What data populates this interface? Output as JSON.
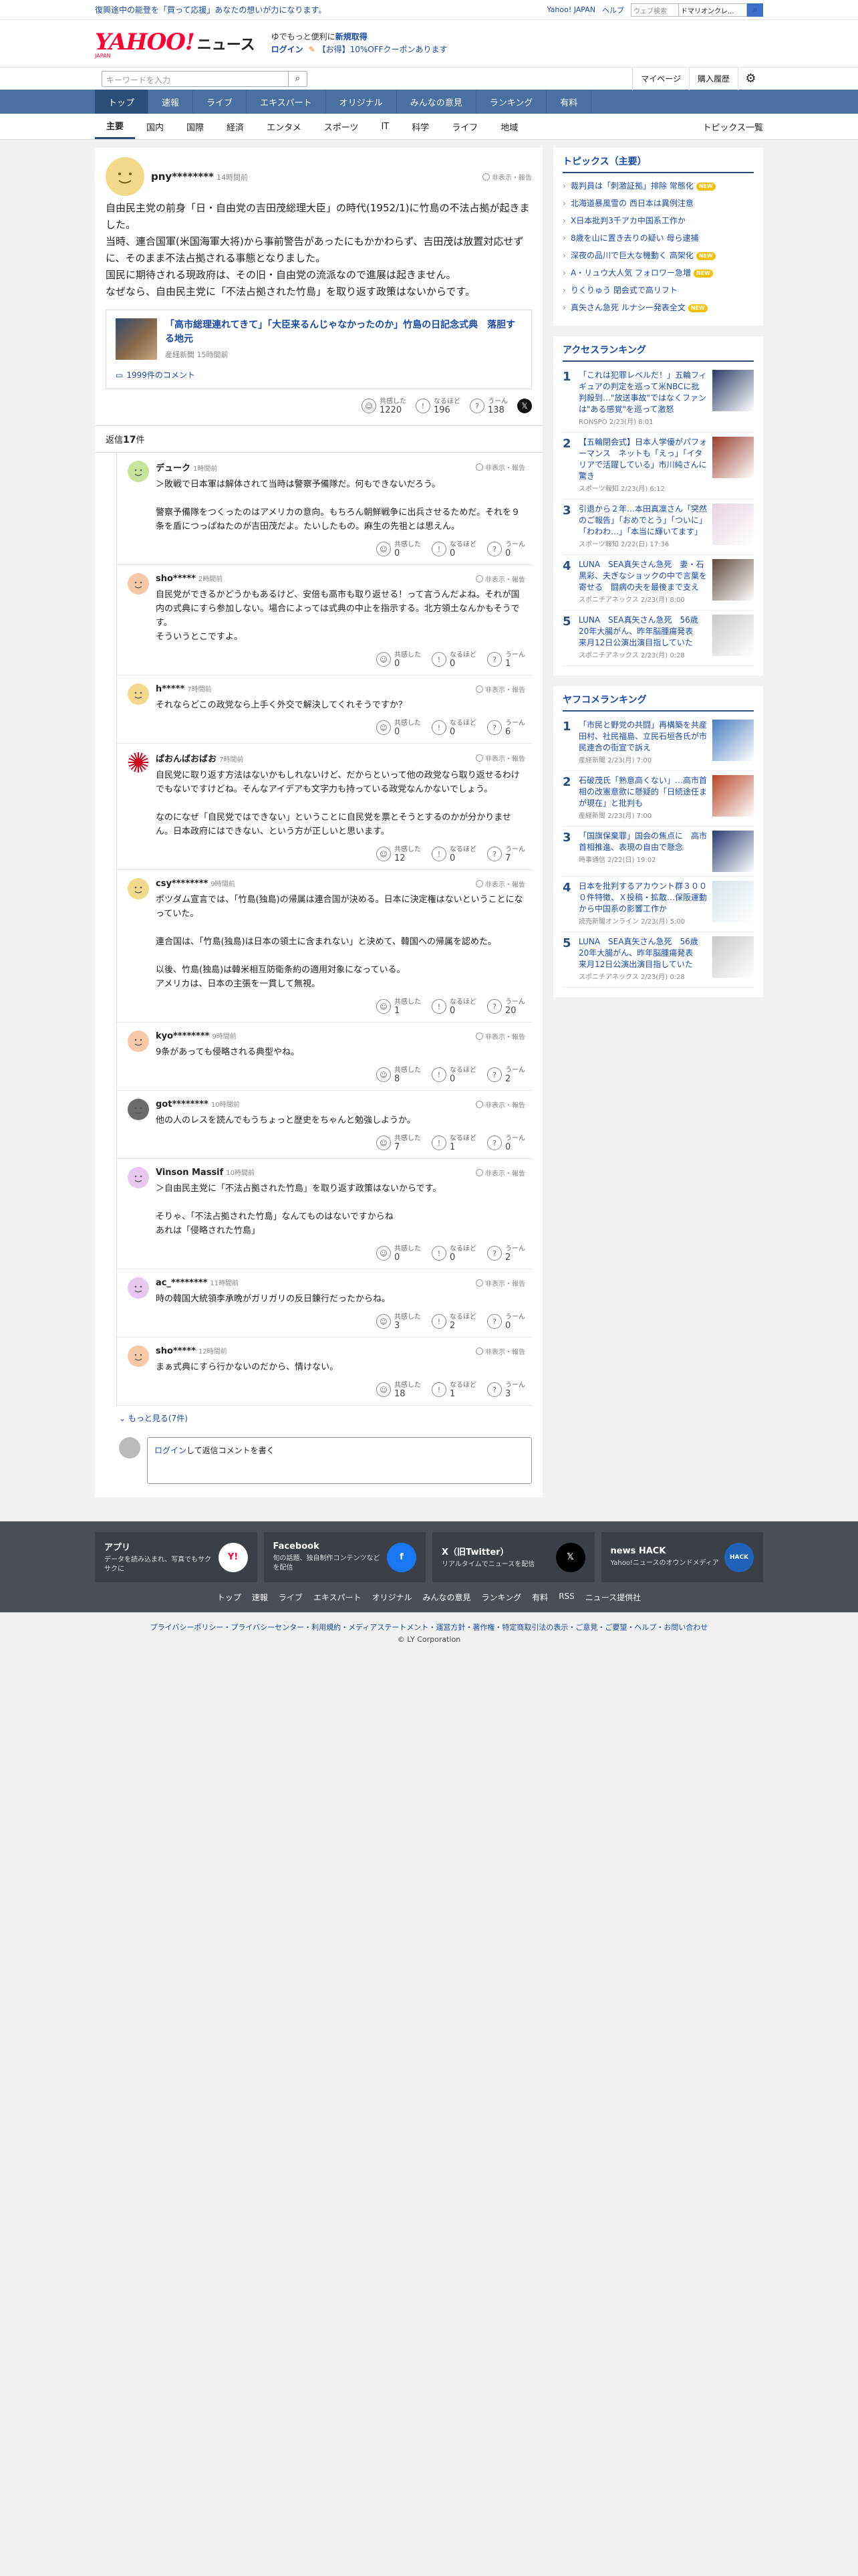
{
  "topstrip": {
    "promo": "復興途中の能登を「買って応援」あなたの想いが力になります。",
    "links": [
      "Yahoo! JAPAN",
      "ヘルプ"
    ],
    "search_placeholder": "ウェブ検索",
    "search_value": "ドマリオンクレ..."
  },
  "header": {
    "logo": "YAHOO!",
    "logo_sub": "JAPAN",
    "logo_news": "ニュース",
    "login_line1_a": "ゆでもっと便利に",
    "login_line1_b": "新規取得",
    "login_label": "ログイン",
    "coupon": "【お得】10%OFFクーポンあります"
  },
  "searchrow": {
    "placeholder": "キーワードを入力",
    "mypage": "マイページ",
    "history": "購入履歴"
  },
  "mainnav": [
    "トップ",
    "速報",
    "ライブ",
    "エキスパート",
    "オリジナル",
    "みんなの意見",
    "ランキング",
    "有料"
  ],
  "subnav": [
    "主要",
    "国内",
    "国際",
    "経済",
    "エンタメ",
    "スポーツ",
    "IT",
    "科学",
    "ライフ",
    "地域"
  ],
  "subnav_more": "トピックス一覧",
  "report": "非表示・報告",
  "topcomment": {
    "user": "pny********",
    "time": "14時間前",
    "body": [
      "自由民主党の前身「日・自由党の吉田茂総理大臣」の時代(1952/1)に竹島の不法占拠が起きました。",
      "当時、連合国軍(米国海軍大将)から事前警告があったにもかかわらず、吉田茂は放置対応せずに、そのまま不法占拠される事態となりました。",
      "国民に期待される現政府は、その旧・自由党の流派なので進展は起きません。",
      "なぜなら、自由民主党に「不法占拠された竹島」を取り返す政策はないからです。"
    ],
    "link_title": "「高市総理連れてきて」「大臣来るんじゃなかったのか」竹島の日記念式典　落胆する地元",
    "link_source": "産経新聞",
    "link_time": "15時間前",
    "comment_count": "1999件のコメント",
    "reacts": [
      {
        "label": "共感した",
        "n": "1220"
      },
      {
        "label": "なるほど",
        "n": "196"
      },
      {
        "label": "うーん",
        "n": "138"
      }
    ]
  },
  "reply_label": "返信",
  "reply_count": "17",
  "reply_unit": "件",
  "replies": [
    {
      "user": "デューク",
      "time": "1時間前",
      "text": [
        "＞敗戦で日本軍は解体されて当時は警察予備隊だ。何もできないだろう。",
        "",
        "警察予備隊をつくったのはアメリカの意向。もちろん朝鮮戦争に出兵させるためだ。それを９条を盾につっぱねたのが吉田茂だよ。たいしたもの。麻生の先祖とは思えん。"
      ],
      "r": [
        "0",
        "0",
        "0"
      ]
    },
    {
      "user": "sho*****",
      "time": "2時間前",
      "text": [
        "自民党ができるかどうかもあるけど、安倍も高市も取り返せる！って言うんだよね。それが国内の式典にすら参加しない。場合によっては式典の中止を指示する。北方領土なんかもそうです。",
        "そういうとこですよ。"
      ],
      "r": [
        "0",
        "0",
        "1"
      ]
    },
    {
      "user": "h*****",
      "time": "7時間前",
      "text": [
        "それならどこの政党なら上手く外交で解決してくれそうですか？"
      ],
      "r": [
        "0",
        "0",
        "6"
      ]
    },
    {
      "user": "ぱおんばおばお",
      "time": "7時間前",
      "text": [
        "自民党に取り返す方法はないかもしれないけど、だからといって他の政党なら取り返せるわけでもないですけどね。そんなアイデアも文字力も持っている政党なんかないでしょう。",
        "",
        "なのになぜ「自民党ではできない」ということに自民党を票とそうとするのかが分かりません。日本政府にはできない、という方が正しいと思います。"
      ],
      "r": [
        "12",
        "0",
        "7"
      ]
    },
    {
      "user": "csy********",
      "time": "9時間前",
      "text": [
        "ポツダム宣言では、「竹島(独島)の帰属は連合国が決める。日本に決定権はないということになっていた。",
        "",
        "連合国は、「竹島(独島)は日本の領土に含まれない」と決めて、韓国への帰属を認めた。",
        "",
        "以後、竹島(独島)は韓米相互防衛条約の適用対象になっている。",
        "アメリカは、日本の主張を一貫して無視。"
      ],
      "r": [
        "1",
        "0",
        "20"
      ]
    },
    {
      "user": "kyo********",
      "time": "9時間前",
      "text": [
        "9条があっても侵略される典型やね。"
      ],
      "r": [
        "8",
        "0",
        "2"
      ]
    },
    {
      "user": "got********",
      "time": "10時間前",
      "text": [
        "他の人のレスを読んでもうちょっと歴史をちゃんと勉強しようか。"
      ],
      "r": [
        "7",
        "1",
        "0"
      ]
    },
    {
      "user": "Vinson Massif",
      "time": "10時間前",
      "text": [
        "＞自由民主党に「不法占拠された竹島」を取り返す政策はないからです。",
        "",
        "そりゃ、「不法占拠された竹島」なんてものはないですからね",
        "あれは「侵略された竹島」"
      ],
      "r": [
        "0",
        "0",
        "2"
      ]
    },
    {
      "user": "ac_********",
      "time": "11時間前",
      "text": [
        "時の韓国大統領李承晩がガリガリの反日錬行だったからね。"
      ],
      "r": [
        "3",
        "2",
        "0"
      ]
    },
    {
      "user": "sho*****",
      "time": "12時間前",
      "text": [
        "まぁ式典にすら行かないのだから、情けない。"
      ],
      "r": [
        "18",
        "1",
        "3"
      ]
    }
  ],
  "react_labels": [
    "共感した",
    "なるほど",
    "うーん"
  ],
  "showmore": "もっと見る(7件)",
  "compose": {
    "login": "ログイン",
    "rest": "して返信コメントを書く"
  },
  "topics": {
    "title": "トピックス（主要）",
    "items": [
      {
        "t": "裁判員は「刺激証拠」排除 常態化",
        "new": true
      },
      {
        "t": "北海道暴風雪の 西日本は異例注意",
        "new": false
      },
      {
        "t": "X日本批判3千アカ中国系工作か",
        "new": false
      },
      {
        "t": "8歳を山に置き去りの疑い 母ら逮捕",
        "new": false
      },
      {
        "t": "深夜の品川で巨大な機動く 高架化",
        "new": true
      },
      {
        "t": "A・リュウ大人気 フォロワー急増",
        "new": true
      },
      {
        "t": "りくりゅう 閉会式で高リフト",
        "new": false
      },
      {
        "t": "真矢さん急死 ルナシー発表全文",
        "new": true
      }
    ]
  },
  "new_label": "NEW",
  "access": {
    "title": "アクセスランキング",
    "items": [
      {
        "t": "「これは犯罪レベルだ！」五輪フィギュアの判定を巡って米NBCに批判殺到…\"放送事故\"ではなくファンは\"ある感覚\"を巡って激怒",
        "s": "RONSPO 2/23(月) 8:01",
        "c": "#2b3b66"
      },
      {
        "t": "【五輪閉会式】日本人学優がパフォーマンス　ネットも「えっ」「イタリアで活躍している」市川純さんに驚き",
        "s": "スポーツ報知 2/23(月) 6:12",
        "c": "#9a3f2f"
      },
      {
        "t": "引退から２年…本田真凜さん「突然のご報告」「おめでとう」「ついに」「わわわ…」「本当に輝いてます」",
        "s": "スポーツ報知 2/22(日) 17:36",
        "c": "#e6d4e2"
      },
      {
        "t": "LUNA　SEA真矢さん急死　妻・石黒彩、夫ぎなショックの中で言葉を寄せる　闘病の夫を最後まで支え",
        "s": "スポニチアネックス 2/23(月) 8:00",
        "c": "#5d4a3f"
      },
      {
        "t": "LUNA　SEA真矢さん急死　56歳　20年大腸がん、昨年脳腫瘍発表　来月12日公演出演目指していた",
        "s": "スポニチアネックス 2/23(月) 0:28",
        "c": "#c9c9c9"
      }
    ]
  },
  "yahoo_rank": {
    "title": "ヤフコメランキング",
    "items": [
      {
        "t": "「市民と野党の共闘」再構築を共産田村、社民福島、立民石垣各氏が市民連合の街宣で訴え",
        "s": "産経新聞 2/23(月) 7:00",
        "c": "#4a7ec2"
      },
      {
        "t": "石破茂氏「熟意高くない」…高市首相の改憲意欲に懸疑的「日続途任まが現在」と批判も",
        "s": "産経新聞 2/23(月) 7:00",
        "c": "#b7472a"
      },
      {
        "t": "「国旗保棄罪」国会の焦点に　高市首相推進、表現の自由で懸念",
        "s": "時事通信 2/22(日) 19:02",
        "c": "#2d3c72"
      },
      {
        "t": "日本を批判するアカウント群３０００件特徴、Ｘ投稿・拡散…保阪運動から中国系の影響工作か",
        "s": "読売新聞オンライン 2/23(月) 5:00",
        "c": "#d7e3ea"
      },
      {
        "t": "LUNA　SEA真矢さん急死　56歳　20年大腸がん、昨年脳腫瘍発表　来月12日公演出演目指していた",
        "s": "スポニチアネックス 2/23(月) 0:28",
        "c": "#c9c9c9"
      }
    ]
  },
  "footer": {
    "cards": [
      {
        "t": "アプリ",
        "d": "データを読み込まれ、写真でもサクサクに",
        "icon": "Y!",
        "c": "#ffffff"
      },
      {
        "t": "Facebook",
        "d": "旬の話題、独自制作コンテンツなどを配信",
        "icon": "f",
        "c": "#1877f2"
      },
      {
        "t": "X（旧Twitter）",
        "d": "リアルタイムでニュースを配信",
        "icon": "𝕏",
        "c": "#000000"
      },
      {
        "t": "news HACK",
        "d": "Yahoo!ニュースのオウンドメディア",
        "icon": "HACK",
        "c": "#1f63b8"
      }
    ],
    "links": [
      "トップ",
      "速報",
      "ライブ",
      "エキスパート",
      "オリジナル",
      "みんなの意見",
      "ランキング",
      "有料",
      "RSS",
      "ニュース提供社"
    ],
    "legal": "プライバシーポリシー・プライバシーセンター・利用規約・メディアステートメント・運営方針・著作権・特定商取引法の表示・ご意見・ご要望・ヘルプ・お問い合わせ",
    "copy": "© LY Corporation"
  }
}
